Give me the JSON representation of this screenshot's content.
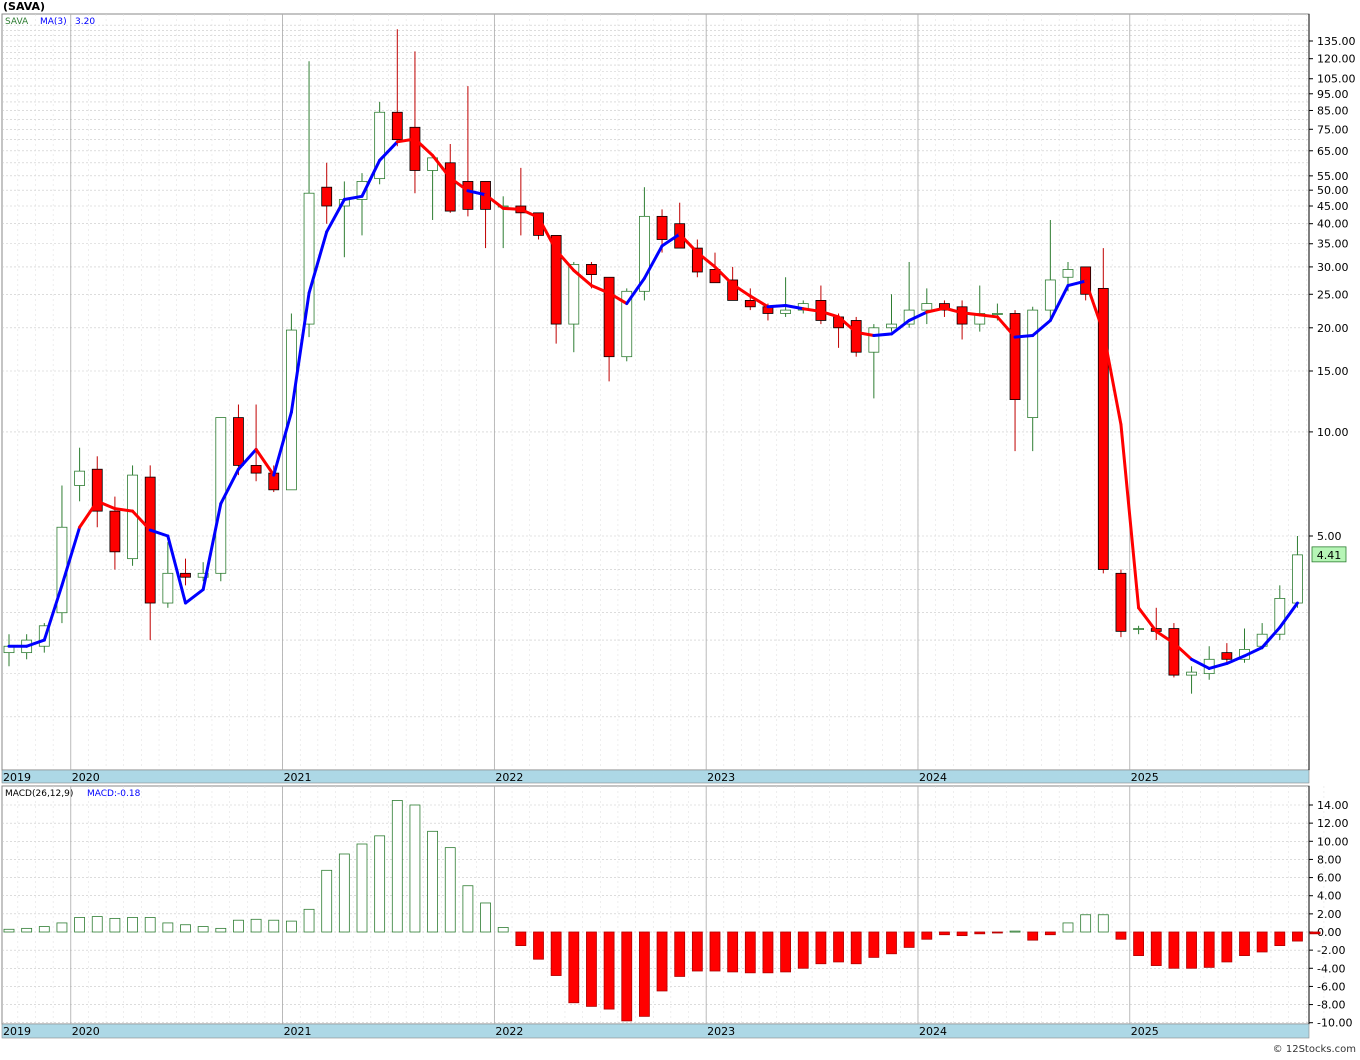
{
  "title": "(SAVA)",
  "credit": "© 12Stocks.com",
  "colors": {
    "up": "#2e7d32",
    "down_fill": "#ff0000",
    "down_stroke": "#c00000",
    "ma_up": "#0000ff",
    "ma_down": "#ff0000",
    "axis_bar": "#add8e6",
    "grid": "#c8c8c8",
    "last_price_bg": "#b6f5b6"
  },
  "price_panel": {
    "legend": {
      "symbol": "SAVA",
      "ma_label": "MA(3)",
      "ma_value": "3.20"
    },
    "last_price_label": "4.41",
    "scale": "log",
    "y_ticks": [
      {
        "v": 135,
        "label": "135.00"
      },
      {
        "v": 120,
        "label": "120.00"
      },
      {
        "v": 105,
        "label": "105.00"
      },
      {
        "v": 95,
        "label": "95.00"
      },
      {
        "v": 85,
        "label": "85.00"
      },
      {
        "v": 75,
        "label": "75.00"
      },
      {
        "v": 65,
        "label": "65.00"
      },
      {
        "v": 55,
        "label": "55.00"
      },
      {
        "v": 50,
        "label": "50.00"
      },
      {
        "v": 45,
        "label": "45.00"
      },
      {
        "v": 40,
        "label": "40.00"
      },
      {
        "v": 35,
        "label": "35.00"
      },
      {
        "v": 30,
        "label": "30.00"
      },
      {
        "v": 25,
        "label": "25.00"
      },
      {
        "v": 20,
        "label": "20.00"
      },
      {
        "v": 15,
        "label": "15.00"
      },
      {
        "v": 10,
        "label": "10.00"
      },
      {
        "v": 5,
        "label": "5.00"
      }
    ],
    "year_labels": [
      {
        "label": "2019",
        "index": -0.4
      },
      {
        "label": "2020",
        "index": 4
      },
      {
        "label": "2021",
        "index": 16
      },
      {
        "label": "2022",
        "index": 28
      },
      {
        "label": "2023",
        "index": 40
      },
      {
        "label": "2024",
        "index": 52
      },
      {
        "label": "2025",
        "index": 64
      }
    ]
  },
  "macd_panel": {
    "legend_label": "MACD(26,12,9)",
    "legend_value": "MACD:-0.18",
    "y_ticks": [
      "14.00",
      "12.00",
      "10.00",
      "8.00",
      "6.00",
      "4.00",
      "2.00",
      "0.00",
      "-2.00",
      "-4.00",
      "-6.00",
      "-8.00",
      "-10.00"
    ],
    "y_values": [
      14,
      12,
      10,
      8,
      6,
      4,
      2,
      0,
      -2,
      -4,
      -6,
      -8,
      -10
    ],
    "year_labels": [
      {
        "label": "2019",
        "index": -0.4
      },
      {
        "label": "2020",
        "index": 4
      },
      {
        "label": "2021",
        "index": 16
      },
      {
        "label": "2022",
        "index": 28
      },
      {
        "label": "2023",
        "index": 40
      },
      {
        "label": "2024",
        "index": 52
      },
      {
        "label": "2025",
        "index": 64
      }
    ]
  },
  "chart_data": {
    "type": "candlestick",
    "period": "monthly",
    "y_scale": "log",
    "candles": [
      {
        "o": 2.3,
        "h": 2.6,
        "l": 2.1,
        "c": 2.4
      },
      {
        "o": 2.3,
        "h": 2.6,
        "l": 2.2,
        "c": 2.5
      },
      {
        "o": 2.4,
        "h": 2.8,
        "l": 2.3,
        "c": 2.75
      },
      {
        "o": 3.0,
        "h": 7.0,
        "l": 2.8,
        "c": 5.3
      },
      {
        "o": 7.0,
        "h": 9.0,
        "l": 6.3,
        "c": 7.7
      },
      {
        "o": 7.8,
        "h": 8.5,
        "l": 5.3,
        "c": 5.9
      },
      {
        "o": 5.9,
        "h": 6.5,
        "l": 4.0,
        "c": 4.5
      },
      {
        "o": 4.3,
        "h": 8.0,
        "l": 4.1,
        "c": 7.5
      },
      {
        "o": 7.4,
        "h": 8.0,
        "l": 2.5,
        "c": 3.2
      },
      {
        "o": 3.2,
        "h": 4.8,
        "l": 3.1,
        "c": 3.9
      },
      {
        "o": 3.9,
        "h": 4.3,
        "l": 3.6,
        "c": 3.8
      },
      {
        "o": 3.8,
        "h": 4.2,
        "l": 3.7,
        "c": 3.9
      },
      {
        "o": 3.9,
        "h": 11.0,
        "l": 3.7,
        "c": 11.0
      },
      {
        "o": 11.0,
        "h": 12.0,
        "l": 7.5,
        "c": 8.0
      },
      {
        "o": 8.0,
        "h": 12.0,
        "l": 7.2,
        "c": 7.6
      },
      {
        "o": 7.6,
        "h": 8.0,
        "l": 6.7,
        "c": 6.8
      },
      {
        "o": 6.8,
        "h": 22.0,
        "l": 6.8,
        "c": 19.7
      },
      {
        "o": 20.5,
        "h": 118.0,
        "l": 18.8,
        "c": 49.0
      },
      {
        "o": 51.0,
        "h": 60.0,
        "l": 40.0,
        "c": 45.0
      },
      {
        "o": 45.0,
        "h": 53.0,
        "l": 32.0,
        "c": 47.0
      },
      {
        "o": 47.0,
        "h": 56.0,
        "l": 37.0,
        "c": 53.0
      },
      {
        "o": 54.0,
        "h": 90.0,
        "l": 52.0,
        "c": 84.0
      },
      {
        "o": 84.0,
        "h": 146.0,
        "l": 67.0,
        "c": 70.0
      },
      {
        "o": 76.0,
        "h": 126.0,
        "l": 49.0,
        "c": 57.0
      },
      {
        "o": 57.0,
        "h": 62.0,
        "l": 41.0,
        "c": 62.0
      },
      {
        "o": 60.0,
        "h": 68.0,
        "l": 43.0,
        "c": 43.5
      },
      {
        "o": 53.0,
        "h": 100.0,
        "l": 42.0,
        "c": 44.0
      },
      {
        "o": 53.0,
        "h": 53.0,
        "l": 34.0,
        "c": 44.0
      },
      {
        "o": 45.0,
        "h": 48.0,
        "l": 34.0,
        "c": 45.0
      },
      {
        "o": 45.0,
        "h": 58.0,
        "l": 37.0,
        "c": 43.0
      },
      {
        "o": 43.0,
        "h": 43.0,
        "l": 36.0,
        "c": 37.0
      },
      {
        "o": 37.0,
        "h": 37.0,
        "l": 18.0,
        "c": 20.5
      },
      {
        "o": 20.5,
        "h": 31.0,
        "l": 17.0,
        "c": 30.5
      },
      {
        "o": 30.5,
        "h": 31.0,
        "l": 26.0,
        "c": 28.5
      },
      {
        "o": 28.0,
        "h": 28.0,
        "l": 14.0,
        "c": 16.5
      },
      {
        "o": 16.5,
        "h": 26.0,
        "l": 16.0,
        "c": 25.5
      },
      {
        "o": 25.5,
        "h": 51.0,
        "l": 24.0,
        "c": 42.0
      },
      {
        "o": 42.0,
        "h": 44.0,
        "l": 33.0,
        "c": 36.0
      },
      {
        "o": 40.0,
        "h": 46.0,
        "l": 34.0,
        "c": 34.0
      },
      {
        "o": 34.0,
        "h": 36.0,
        "l": 28.0,
        "c": 29.0
      },
      {
        "o": 29.5,
        "h": 33.0,
        "l": 27.0,
        "c": 27.0
      },
      {
        "o": 27.5,
        "h": 30.0,
        "l": 24.0,
        "c": 24.0
      },
      {
        "o": 24.0,
        "h": 26.0,
        "l": 22.5,
        "c": 23.0
      },
      {
        "o": 23.0,
        "h": 23.5,
        "l": 21.0,
        "c": 22.0
      },
      {
        "o": 22.0,
        "h": 28.0,
        "l": 21.5,
        "c": 22.5
      },
      {
        "o": 22.5,
        "h": 24.0,
        "l": 22.0,
        "c": 23.5
      },
      {
        "o": 24.0,
        "h": 26.5,
        "l": 20.5,
        "c": 21.0
      },
      {
        "o": 21.5,
        "h": 22.0,
        "l": 17.5,
        "c": 20.0
      },
      {
        "o": 21.0,
        "h": 21.5,
        "l": 16.5,
        "c": 17.0
      },
      {
        "o": 17.0,
        "h": 20.5,
        "l": 12.5,
        "c": 20.0
      },
      {
        "o": 20.0,
        "h": 25.0,
        "l": 19.5,
        "c": 20.5
      },
      {
        "o": 20.5,
        "h": 31.0,
        "l": 20.0,
        "c": 22.5
      },
      {
        "o": 22.5,
        "h": 26.0,
        "l": 20.5,
        "c": 23.5
      },
      {
        "o": 23.5,
        "h": 24.0,
        "l": 21.5,
        "c": 22.5
      },
      {
        "o": 23.0,
        "h": 24.0,
        "l": 18.5,
        "c": 20.5
      },
      {
        "o": 20.5,
        "h": 26.5,
        "l": 19.5,
        "c": 22.0
      },
      {
        "o": 22.0,
        "h": 23.5,
        "l": 21.0,
        "c": 22.0
      },
      {
        "o": 22.0,
        "h": 22.5,
        "l": 8.8,
        "c": 12.4
      },
      {
        "o": 11.0,
        "h": 23.0,
        "l": 8.8,
        "c": 22.5
      },
      {
        "o": 22.5,
        "h": 41.0,
        "l": 21.0,
        "c": 27.5
      },
      {
        "o": 28.0,
        "h": 31.0,
        "l": 25.5,
        "c": 29.5
      },
      {
        "o": 30.0,
        "h": 30.0,
        "l": 24.0,
        "c": 25.0
      },
      {
        "o": 26.0,
        "h": 34.0,
        "l": 3.9,
        "c": 4.0
      },
      {
        "o": 3.9,
        "h": 4.0,
        "l": 2.55,
        "c": 2.65
      },
      {
        "o": 2.7,
        "h": 2.75,
        "l": 2.6,
        "c": 2.7
      },
      {
        "o": 2.7,
        "h": 3.1,
        "l": 2.5,
        "c": 2.65
      },
      {
        "o": 2.7,
        "h": 2.8,
        "l": 1.95,
        "c": 1.98
      },
      {
        "o": 1.98,
        "h": 2.1,
        "l": 1.75,
        "c": 2.02
      },
      {
        "o": 2.0,
        "h": 2.4,
        "l": 1.92,
        "c": 2.2
      },
      {
        "o": 2.3,
        "h": 2.45,
        "l": 2.15,
        "c": 2.2
      },
      {
        "o": 2.2,
        "h": 2.7,
        "l": 2.15,
        "c": 2.35
      },
      {
        "o": 2.4,
        "h": 2.8,
        "l": 2.35,
        "c": 2.6
      },
      {
        "o": 2.6,
        "h": 3.6,
        "l": 2.5,
        "c": 3.3
      },
      {
        "o": 3.2,
        "h": 5.0,
        "l": 3.1,
        "c": 4.41
      }
    ],
    "ma3": [
      2.4,
      2.4,
      2.5,
      3.6,
      5.3,
      6.3,
      6.0,
      5.9,
      5.2,
      5.0,
      3.2,
      3.5,
      6.2,
      7.8,
      8.9,
      7.5,
      11.4,
      25.2,
      37.9,
      47.0,
      48.0,
      61.0,
      69.0,
      70.3,
      63.0,
      54.2,
      49.8,
      48.5,
      44.3,
      44.0,
      41.7,
      33.5,
      29.3,
      26.5,
      25.2,
      23.5,
      27.8,
      34.5,
      37.3,
      33.0,
      30.0,
      26.7,
      24.7,
      23.0,
      23.2,
      22.7,
      22.3,
      21.5,
      19.4,
      19.0,
      19.2,
      21.0,
      22.2,
      22.8,
      22.1,
      21.8,
      21.5,
      18.8,
      19.0,
      21.0,
      26.5,
      27.3,
      19.5,
      10.5,
      3.1,
      2.65,
      2.45,
      2.2,
      2.07,
      2.14,
      2.25,
      2.38,
      2.72,
      3.2
    ],
    "ma3_color": [
      "up",
      "up",
      "up",
      "up",
      "up",
      "down",
      "down",
      "down",
      "down",
      "up",
      "up",
      "up",
      "up",
      "up",
      "up",
      "down",
      "up",
      "up",
      "up",
      "up",
      "up",
      "up",
      "up",
      "down",
      "down",
      "down",
      "down",
      "up",
      "down",
      "down",
      "down",
      "down",
      "down",
      "down",
      "down",
      "down",
      "up",
      "up",
      "up",
      "down",
      "down",
      "down",
      "down",
      "down",
      "up",
      "up",
      "down",
      "down",
      "down",
      "down",
      "up",
      "up",
      "up",
      "down",
      "down",
      "down",
      "down",
      "down",
      "up",
      "up",
      "up",
      "up",
      "down",
      "down",
      "down",
      "down",
      "down",
      "down",
      "up",
      "up",
      "up",
      "up",
      "up",
      "up"
    ],
    "macd_hist": [
      0.3,
      0.4,
      0.6,
      1.0,
      1.6,
      1.7,
      1.5,
      1.6,
      1.6,
      1.0,
      0.8,
      0.6,
      0.4,
      1.3,
      1.4,
      1.3,
      1.2,
      2.5,
      6.8,
      8.6,
      9.7,
      10.6,
      14.5,
      14.0,
      11.1,
      9.3,
      5.1,
      3.2,
      0.5,
      -1.5,
      -3.0,
      -4.8,
      -7.8,
      -8.2,
      -8.5,
      -9.8,
      -9.3,
      -6.5,
      -4.9,
      -4.3,
      -4.3,
      -4.4,
      -4.5,
      -4.5,
      -4.4,
      -4.0,
      -3.5,
      -3.3,
      -3.5,
      -2.8,
      -2.4,
      -1.7,
      -0.8,
      -0.3,
      -0.4,
      -0.2,
      -0.1,
      0.1,
      -0.9,
      -0.3,
      1.0,
      1.9,
      1.9,
      -0.8,
      -2.6,
      -3.7,
      -4.0,
      -4.0,
      -3.9,
      -3.3,
      -2.6,
      -2.2,
      -1.5,
      -1.0,
      -0.2
    ],
    "last_macd": -0.18
  }
}
